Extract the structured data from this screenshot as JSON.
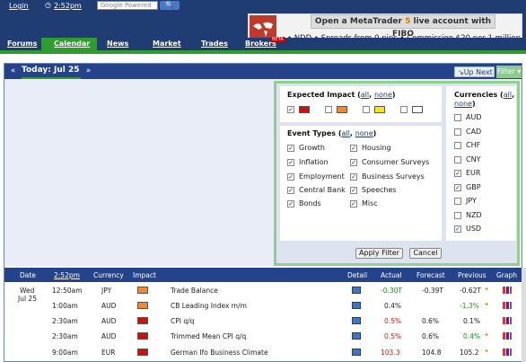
{
  "topbar": {
    "login": "Login",
    "time": "2:52pm",
    "search_placeholder": "Google Powered",
    "search_button": "🔍"
  },
  "ad": {
    "title_pre": "Open a MetaTrader",
    "title_hl": "5",
    "title_post": "live account with FIBO",
    "line": "• NDD  • Spreads from 0 pips  • Commission $20 per 1 million",
    "beta": "BETA"
  },
  "nav": {
    "items": [
      "Forums",
      "Calendar",
      "News",
      "Market",
      "Trades",
      "Brokers"
    ],
    "active": "Calendar"
  },
  "calendar": {
    "prev": "«",
    "today": "Today: Jul 25",
    "next": "»",
    "up_next": "Up Next",
    "filter": "Filter"
  },
  "filter": {
    "impact_title": "Expected Impact",
    "all": "all",
    "none": "none",
    "impact_levels": [
      {
        "name": "high",
        "checked": true,
        "color": "#cc1111"
      },
      {
        "name": "medium",
        "checked": false,
        "color": "#f08a2c"
      },
      {
        "name": "low",
        "checked": false,
        "color": "#f5e614"
      },
      {
        "name": "non-economic",
        "checked": false,
        "color": "#ffffff"
      }
    ],
    "event_title": "Event Types",
    "events_left": [
      "Growth",
      "Inflation",
      "Employment",
      "Central Bank",
      "Bonds"
    ],
    "events_right": [
      "Housing",
      "Consumer Surveys",
      "Business Surveys",
      "Speeches",
      "Misc"
    ],
    "currency_title": "Currencies",
    "currencies": [
      {
        "code": "AUD",
        "checked": false
      },
      {
        "code": "CAD",
        "checked": false
      },
      {
        "code": "CHF",
        "checked": false
      },
      {
        "code": "CNY",
        "checked": false
      },
      {
        "code": "EUR",
        "checked": true
      },
      {
        "code": "GBP",
        "checked": true
      },
      {
        "code": "JPY",
        "checked": false
      },
      {
        "code": "NZD",
        "checked": false
      },
      {
        "code": "USD",
        "checked": true
      }
    ],
    "apply": "Apply Filter",
    "cancel": "Cancel"
  },
  "table": {
    "headers": {
      "date": "Date",
      "time": "2:52pm",
      "currency": "Currency",
      "impact": "Impact",
      "detail": "Detail",
      "actual": "Actual",
      "forecast": "Forecast",
      "previous": "Previous",
      "graph": "Graph"
    },
    "date_day": "Wed",
    "date_val": "Jul 25",
    "rows": [
      {
        "time": "12:50am",
        "currency": "JPY",
        "impact": "medium",
        "event": "Trade Balance",
        "actual": "-0.30T",
        "actual_cls": "pos",
        "forecast": "-0.39T",
        "previous": "-0.62T",
        "prev_cls": "",
        "revised": true
      },
      {
        "time": "1:00am",
        "currency": "AUD",
        "impact": "medium",
        "event": "CB Leading Index m/m",
        "actual": "0.4%",
        "actual_cls": "",
        "forecast": "",
        "previous": "-1.3%",
        "prev_cls": "pos",
        "revised": true
      },
      {
        "time": "2:30am",
        "currency": "AUD",
        "impact": "high",
        "event": "CPI q/q",
        "actual": "0.5%",
        "actual_cls": "neg",
        "forecast": "0.6%",
        "previous": "0.1%",
        "prev_cls": "",
        "revised": false
      },
      {
        "time": "2:30am",
        "currency": "AUD",
        "impact": "high",
        "event": "Trimmed Mean CPI q/q",
        "actual": "0.5%",
        "actual_cls": "neg",
        "forecast": "0.6%",
        "previous": "0.4%",
        "prev_cls": "pos",
        "revised": true
      },
      {
        "time": "9:00am",
        "currency": "EUR",
        "impact": "high",
        "event": "German Ifo Business Climate",
        "actual": "103.3",
        "actual_cls": "neg",
        "forecast": "104.8",
        "previous": "105.2",
        "prev_cls": "",
        "revised": true
      }
    ]
  },
  "colors": {
    "navy": "#1f3d72",
    "green": "#2f9c2f",
    "high": "#cc1111",
    "medium": "#f08a2c"
  }
}
